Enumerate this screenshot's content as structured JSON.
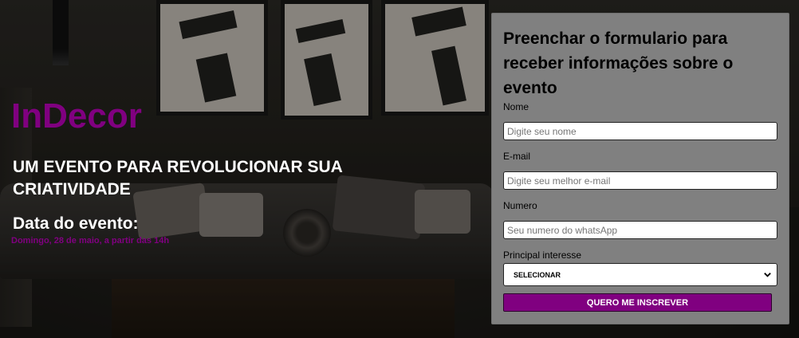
{
  "hero": {
    "brand": "InDecor",
    "tagline": "UM EVENTO PARA REVOLUCIONAR SUA CRIATIVIDADE",
    "date_title": "Data do evento:",
    "date_detail": "Domingo, 28 de maio, a partir das 14h"
  },
  "form": {
    "title": "Preenchar o formulario para receber informações sobre o evento",
    "fields": [
      {
        "label": "Nome",
        "placeholder": "Digite seu nome"
      },
      {
        "label": "E-mail",
        "placeholder": "Digite seu melhor e-mail"
      },
      {
        "label": "Numero",
        "placeholder": "Seu numero do whatsApp"
      }
    ],
    "interest": {
      "label": "Principal interesse",
      "selected": "SELECIONAR"
    },
    "submit_label": "QUERO ME INSCREVER"
  },
  "colors": {
    "brand": "#800080",
    "form_background": "#808080",
    "text_light": "#ffffff"
  }
}
